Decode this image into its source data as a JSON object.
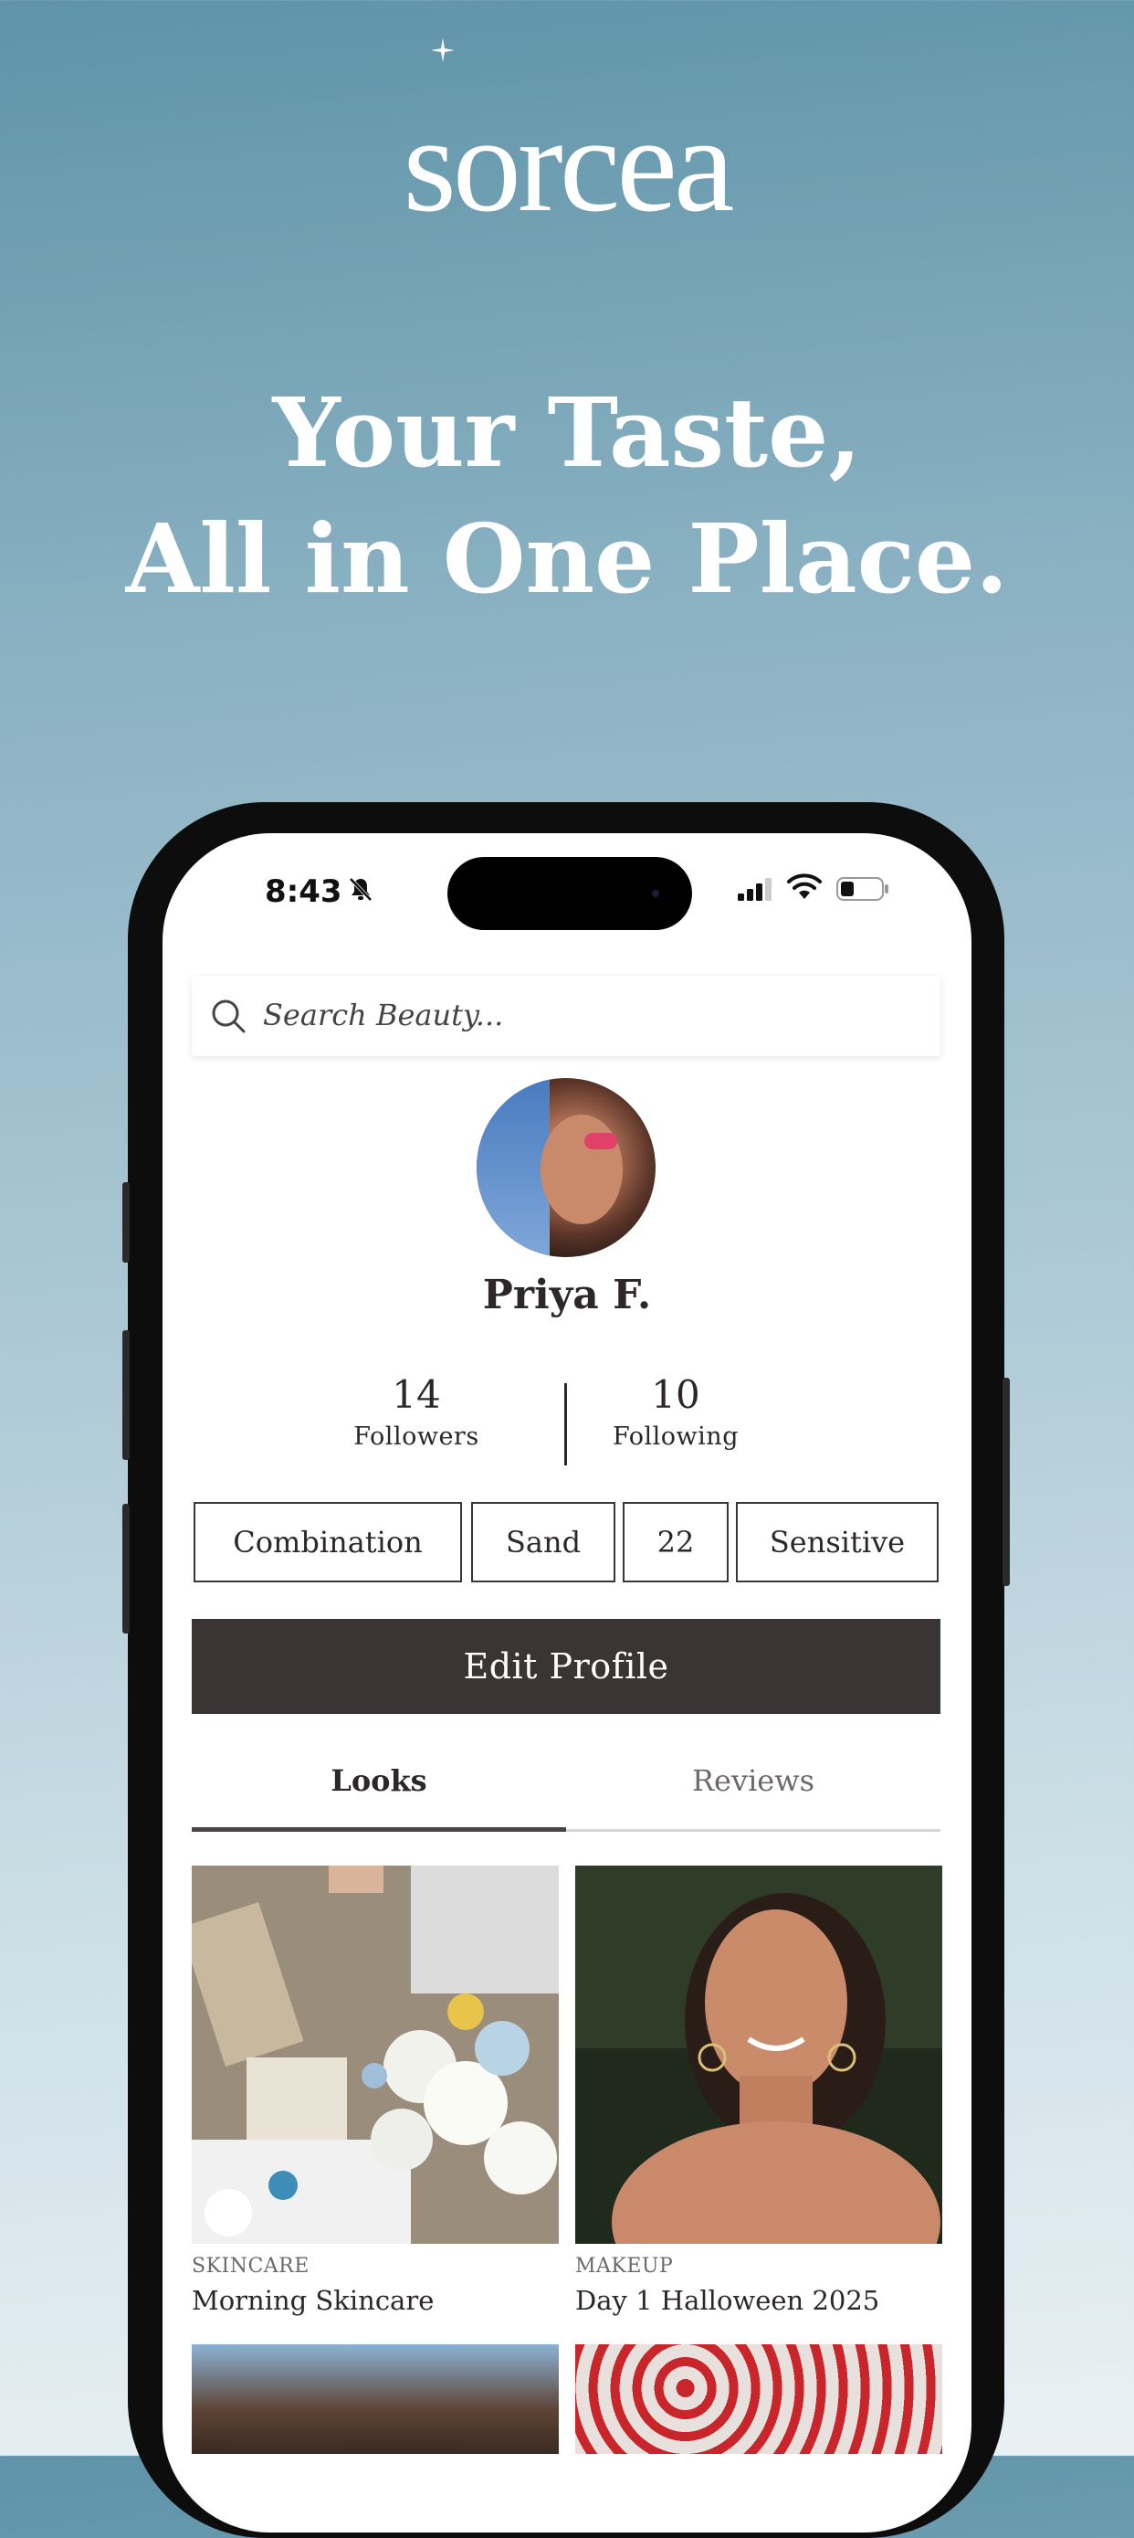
{
  "brand": {
    "logo_text": "sorcea"
  },
  "headline": {
    "line1": "Your Taste,",
    "line2": "All in One Place."
  },
  "status_bar": {
    "time": "8:43"
  },
  "search": {
    "placeholder": "Search Beauty..."
  },
  "profile": {
    "name": "Priya F.",
    "followers_count": "14",
    "followers_label": "Followers",
    "following_count": "10",
    "following_label": "Following",
    "tags": [
      "Combination",
      "Sand",
      "22",
      "Sensitive"
    ],
    "edit_button": "Edit Profile"
  },
  "tabs": [
    {
      "label": "Looks",
      "active": true
    },
    {
      "label": "Reviews",
      "active": false
    }
  ],
  "looks": [
    {
      "category": "SKINCARE",
      "title": "Morning Skincare"
    },
    {
      "category": "MAKEUP",
      "title": "Day 1 Halloween 2025"
    }
  ],
  "colors": {
    "primary_dark": "#3b3434",
    "text": "#2d2727",
    "bg_top": "#5f93a8",
    "bg_bottom": "#e9f1f4"
  }
}
